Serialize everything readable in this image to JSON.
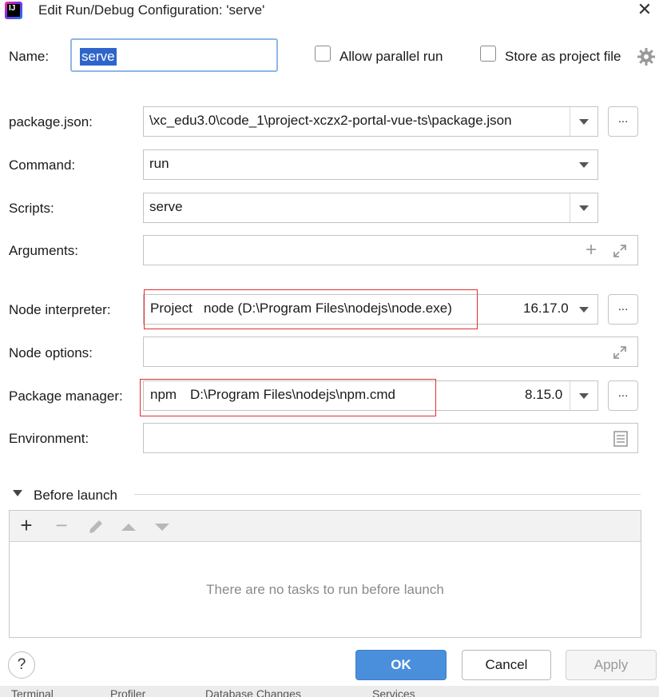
{
  "window": {
    "title": "Edit Run/Debug Configuration: 'serve'"
  },
  "name": {
    "label": "Name:",
    "value": "serve"
  },
  "options": {
    "allow_parallel_run": "Allow parallel run",
    "store_as_project_file": "Store as project file"
  },
  "fields": {
    "package_json": {
      "label": "package.json:",
      "value": "\\xc_edu3.0\\code_1\\project-xczx2-portal-vue-ts\\package.json",
      "button": "..."
    },
    "command": {
      "label": "Command:",
      "value": "run"
    },
    "scripts": {
      "label": "Scripts:",
      "value": "serve"
    },
    "arguments": {
      "label": "Arguments:",
      "value": ""
    },
    "node_interpreter": {
      "label": "Node interpreter:",
      "kind": "Project",
      "path": "node (D:\\Program Files\\nodejs\\node.exe)",
      "version": "16.17.0",
      "button": "..."
    },
    "node_options": {
      "label": "Node options:",
      "value": ""
    },
    "package_manager": {
      "label": "Package manager:",
      "name": "npm",
      "path": "D:\\Program Files\\nodejs\\npm.cmd",
      "version": "8.15.0",
      "button": "..."
    },
    "environment": {
      "label": "Environment:",
      "value": ""
    }
  },
  "before_launch": {
    "title": "Before launch",
    "empty_text": "There are no tasks to run before launch"
  },
  "buttons": {
    "ok": "OK",
    "cancel": "Cancel",
    "apply": "Apply",
    "help": "?"
  },
  "bottom_tabs": [
    "Terminal",
    "Profiler",
    "Database Changes",
    "Services"
  ],
  "colors": {
    "accent": "#4a8fdc",
    "highlight_border": "#e03030",
    "selection": "#2f65ca"
  }
}
